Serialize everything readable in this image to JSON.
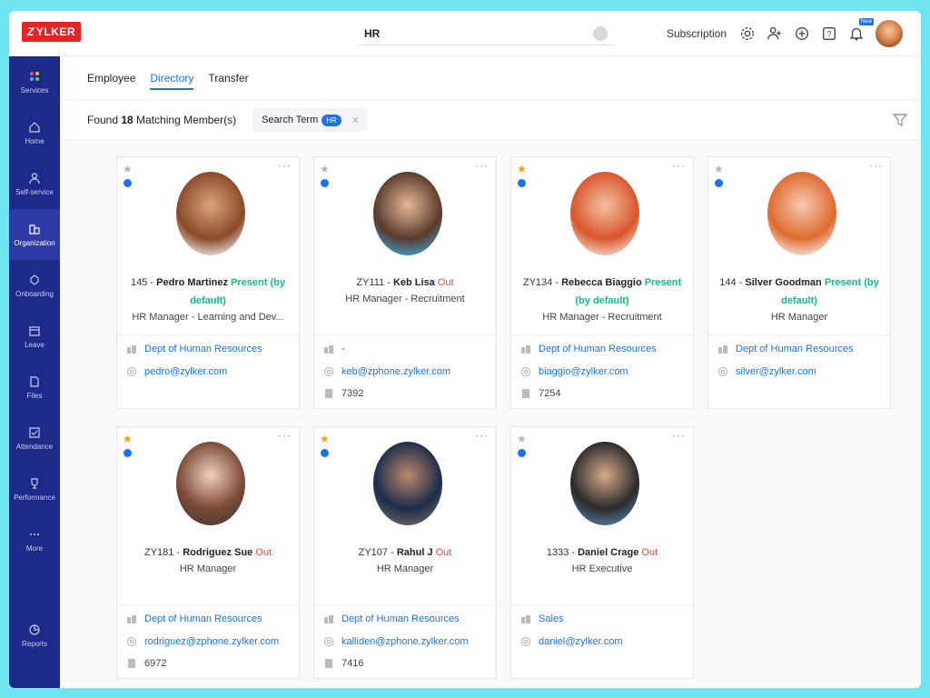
{
  "app": {
    "logo_text": "ZYLKER",
    "logo_letter": "Z",
    "logo_rest": "YLKER"
  },
  "search": {
    "value": "HR"
  },
  "topbar": {
    "subscription": "Subscription",
    "new_badge": "New"
  },
  "sidebar": {
    "items": [
      {
        "label": "Services",
        "icon": "services-icon"
      },
      {
        "label": "Home",
        "icon": "home-icon"
      },
      {
        "label": "Self-service",
        "icon": "user-icon"
      },
      {
        "label": "Organization",
        "icon": "organization-icon"
      },
      {
        "label": "Onboarding",
        "icon": "onboarding-icon"
      },
      {
        "label": "Leave",
        "icon": "calendar-icon"
      },
      {
        "label": "Files",
        "icon": "files-icon"
      },
      {
        "label": "Attendance",
        "icon": "attendance-icon"
      },
      {
        "label": "Performance",
        "icon": "trophy-icon"
      },
      {
        "label": "More",
        "icon": "more-icon"
      }
    ],
    "reports": "Reports"
  },
  "tabs": [
    "Employee",
    "Directory",
    "Transfer"
  ],
  "active_tab": "Directory",
  "filter": {
    "found_prefix": "Found ",
    "found_count": "18",
    "found_suffix": " Matching Member(s)",
    "search_term_label": "Search Term",
    "search_term_value": "HR",
    "close": "×"
  },
  "cards": [
    {
      "id": "145",
      "name": "Pedro Martinez",
      "status": "Present",
      "status_extra": "(by default)",
      "role": "HR Manager - Learning and Dev...",
      "dept": "Dept of Human Resources",
      "email": "pedro@zylker.com",
      "ext": "",
      "favorite": false
    },
    {
      "id": "ZY111",
      "name": "Keb Lisa",
      "status": "Out",
      "status_extra": "",
      "role": "HR Manager - Recruitment",
      "dept": "-",
      "email": "keb@zphone.zylker.com",
      "ext": "7392",
      "favorite": false
    },
    {
      "id": "ZY134",
      "name": "Rebecca Biaggio",
      "status": "Present",
      "status_extra": "(by default)",
      "role": "HR Manager - Recruitment",
      "dept": "Dept of Human Resources",
      "email": "biaggio@zylker.com",
      "ext": "7254",
      "favorite": true
    },
    {
      "id": "144",
      "name": "Silver Goodman",
      "status": "Present",
      "status_extra": "(by default)",
      "role": "HR Manager",
      "dept": "Dept of Human Resources",
      "email": "silver@zylker.com",
      "ext": "",
      "favorite": false
    },
    {
      "id": "ZY181",
      "name": "Rodriguez Sue",
      "status": "Out",
      "status_extra": "",
      "role": "HR Manager",
      "dept": "Dept of Human Resources",
      "email": "rodriguez@zphone.zylker.com",
      "ext": "6972",
      "favorite": true
    },
    {
      "id": "ZY107",
      "name": "Rahul J",
      "status": "Out",
      "status_extra": "",
      "role": "HR Manager",
      "dept": "Dept of Human Resources",
      "email": "kalliden@zphone.zylker.com",
      "ext": "7416",
      "favorite": true
    },
    {
      "id": "1333",
      "name": "Daniel Crage",
      "status": "Out",
      "status_extra": "",
      "role": "HR Executive",
      "dept": "Sales",
      "email": "daniel@zylker.com",
      "ext": "",
      "favorite": false
    }
  ],
  "colors": {
    "accent": "#1a73e8",
    "sidebar": "#1e2a8a",
    "present": "#16b88c",
    "out": "#e74c3c",
    "favorite": "#f39c12"
  }
}
